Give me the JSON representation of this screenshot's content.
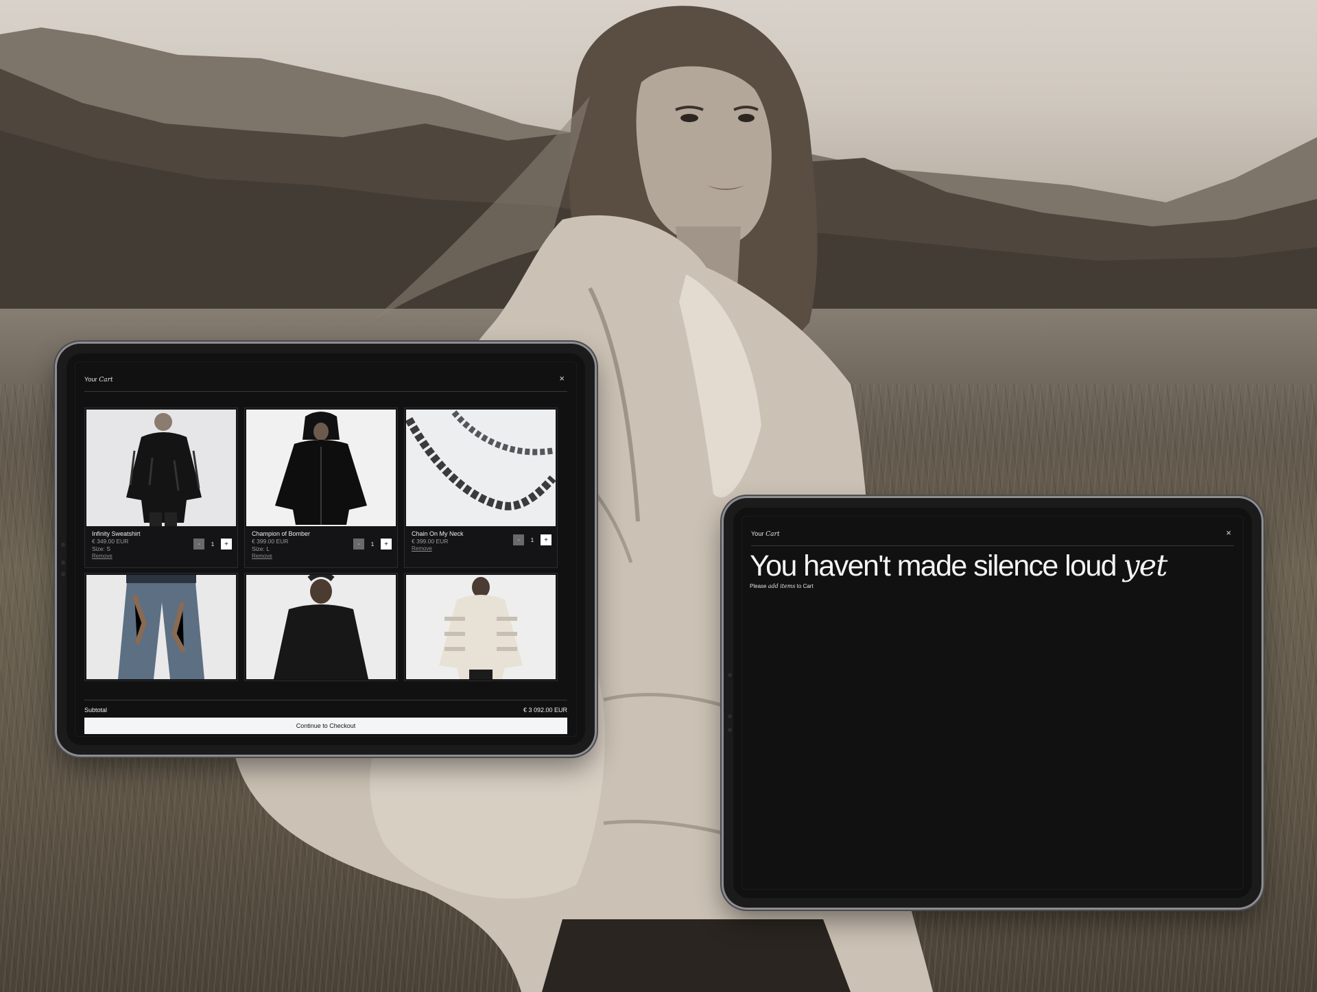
{
  "cart_filled": {
    "title": "Your ",
    "title_italic": "Cart",
    "close_label": "×",
    "items": [
      {
        "name": "Infinity Sweatshirt",
        "price": "€ 349.00 EUR",
        "size": "Size: S",
        "remove": "Remove",
        "qty": "1",
        "minus": "-",
        "plus": "+"
      },
      {
        "name": "Champion of Bomber",
        "price": "€ 399.00 EUR",
        "size": "Size: L",
        "remove": "Remove",
        "qty": "1",
        "minus": "-",
        "plus": "+"
      },
      {
        "name": "Chain On My Neck",
        "price": "€ 399.00 EUR",
        "remove": "Remove",
        "qty": "1",
        "minus": "-",
        "plus": "+"
      }
    ],
    "subtotal_label": "Subtotal",
    "subtotal_value": "€ 3 092.00 EUR",
    "checkout_label": "Continue to Checkout"
  },
  "cart_empty": {
    "title": "Your ",
    "title_italic": "Cart",
    "close_label": "×",
    "headline": "You haven't made silence loud ",
    "headline_italic": "yet",
    "sub_before": "Please ",
    "sub_italic": "add items",
    "sub_after": " to Cart"
  },
  "colors": {
    "screen_bg": "#111112",
    "checkout_bg": "#f4f5f7",
    "minus_btn": "#6a6a6d",
    "plus_btn": "#ffffff"
  }
}
